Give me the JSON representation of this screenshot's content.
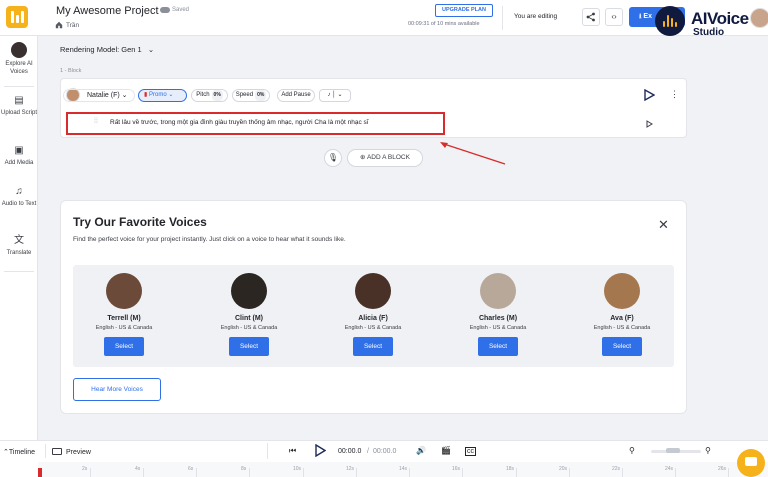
{
  "header": {
    "project_title": "My Awesome Project",
    "saved_text": "Saved",
    "breadcrumb": "Trần",
    "upgrade_label": "UPGRADE PLAN",
    "usage_text": "00:09:31 of 10 mins available",
    "editing_text": "You are editing",
    "export_label": "Ex",
    "brand_name": "AIVoice",
    "brand_sub": "Studio"
  },
  "sidebar": {
    "items": [
      {
        "label": "Explore AI Voices",
        "icon": "avatar"
      },
      {
        "label": "Upload Script",
        "icon": "upload-script-icon"
      },
      {
        "label": "Add Media",
        "icon": "media-icon"
      },
      {
        "label": "Audio to Text",
        "icon": "audio-text-icon"
      },
      {
        "label": "Translate",
        "icon": "translate-icon"
      }
    ]
  },
  "editor": {
    "rendering_model": "Rendering Model: Gen 1",
    "block_label": "1 - Block",
    "voice_name": "Natalie (F)",
    "style_label": "Promo",
    "pitch_label": "Pitch",
    "pitch_value": "0%",
    "speed_label": "Speed",
    "speed_value": "0%",
    "add_pause_label": "Add Pause",
    "block_text": "Rất lâu về trước, trong một gia đình giàu truyền thống âm nhạc, người Cha là một nhạc sĩ",
    "add_block_label": "ADD A BLOCK"
  },
  "favorites": {
    "title": "Try Our Favorite Voices",
    "description": "Find the perfect voice for your project instantly. Just click on a voice to hear what it sounds like.",
    "select_label": "Select",
    "hear_more_label": "Hear More Voices",
    "voices": [
      {
        "name": "Terrell (M)",
        "lang": "English - US & Canada",
        "color": "#6b4a3a"
      },
      {
        "name": "Clint (M)",
        "lang": "English - US & Canada",
        "color": "#2b2622"
      },
      {
        "name": "Alicia (F)",
        "lang": "English - US & Canada",
        "color": "#4a3128"
      },
      {
        "name": "Charles (M)",
        "lang": "English - US & Canada",
        "color": "#b8a89a"
      },
      {
        "name": "Ava (F)",
        "lang": "English - US & Canada",
        "color": "#a4774f"
      }
    ]
  },
  "bottom": {
    "timeline_label": "Timeline",
    "preview_label": "Preview",
    "time_current": "00:00.0",
    "time_separator": "/",
    "time_total": "00:00.0",
    "ruler_ticks": [
      "2s",
      "4s",
      "6s",
      "8s",
      "10s",
      "12s",
      "14s",
      "16s",
      "18s",
      "20s",
      "22s",
      "24s",
      "26s"
    ]
  },
  "colors": {
    "accent": "#2f6fe8",
    "brand_yellow": "#f6b21b",
    "highlight_red": "#d92b2b"
  }
}
